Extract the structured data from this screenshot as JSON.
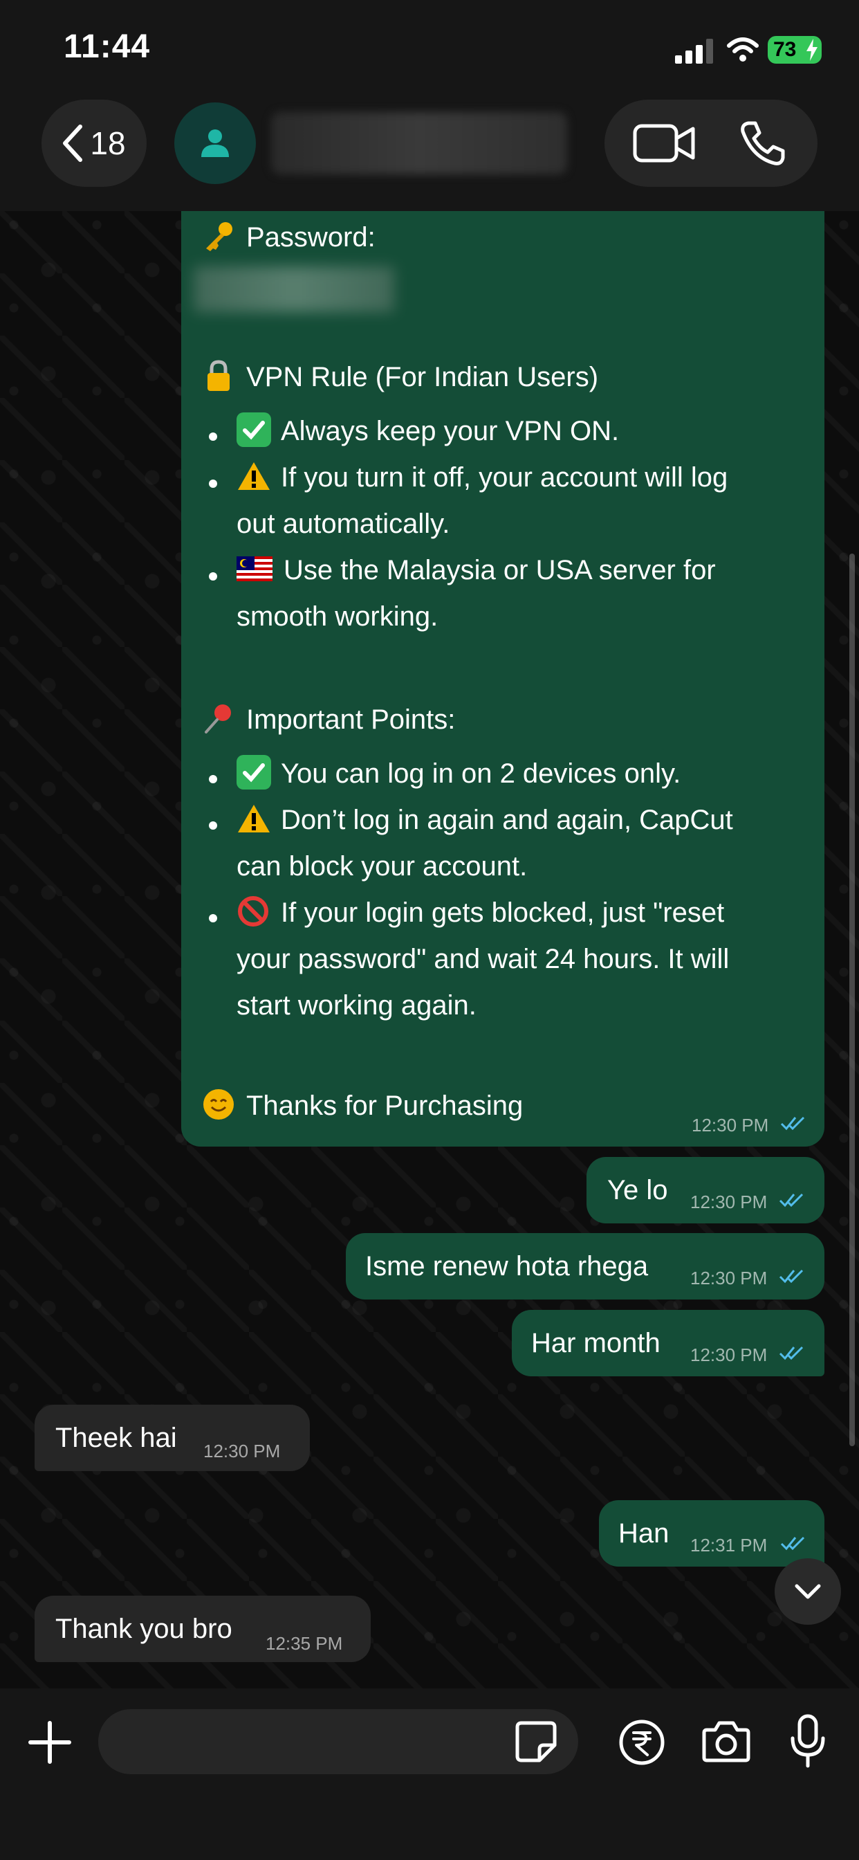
{
  "status_bar": {
    "time": "11:44",
    "battery": "73"
  },
  "header": {
    "back_count": "18"
  },
  "big_message": {
    "password_label": "Password:",
    "vpn_title": "VPN Rule (For Indian Users)",
    "vpn_points": [
      "Always keep your VPN ON.",
      "If you turn it off, your account will log",
      "out automatically.",
      "Use the Malaysia or USA server for",
      "smooth working."
    ],
    "important_title": "Important Points:",
    "important_points": [
      "You can log in on 2 devices only.",
      "Don’t log in again and again, CapCut",
      "can block your account.",
      "If your login gets blocked, just \"reset",
      "your password\" and wait 24 hours. It will",
      "start working again."
    ],
    "thanks": "Thanks for Purchasing",
    "time": "12:30 PM"
  },
  "messages": [
    {
      "text": "Ye lo",
      "time": "12:30 PM",
      "direction": "outgoing"
    },
    {
      "text": "Isme renew hota rhega",
      "time": "12:30 PM",
      "direction": "outgoing"
    },
    {
      "text": "Har month",
      "time": "12:30 PM",
      "direction": "outgoing"
    },
    {
      "text": "Theek hai",
      "time": "12:30 PM",
      "direction": "incoming"
    },
    {
      "text": "Han",
      "time": "12:31 PM",
      "direction": "outgoing"
    },
    {
      "text": "Thank you bro",
      "time": "12:35 PM",
      "direction": "incoming"
    }
  ],
  "composer": {
    "placeholder": ""
  },
  "colors": {
    "outgoing_bubble": "#144d37",
    "incoming_bubble": "#262626",
    "read_ticks": "#53bdeb",
    "battery": "#34c759"
  }
}
